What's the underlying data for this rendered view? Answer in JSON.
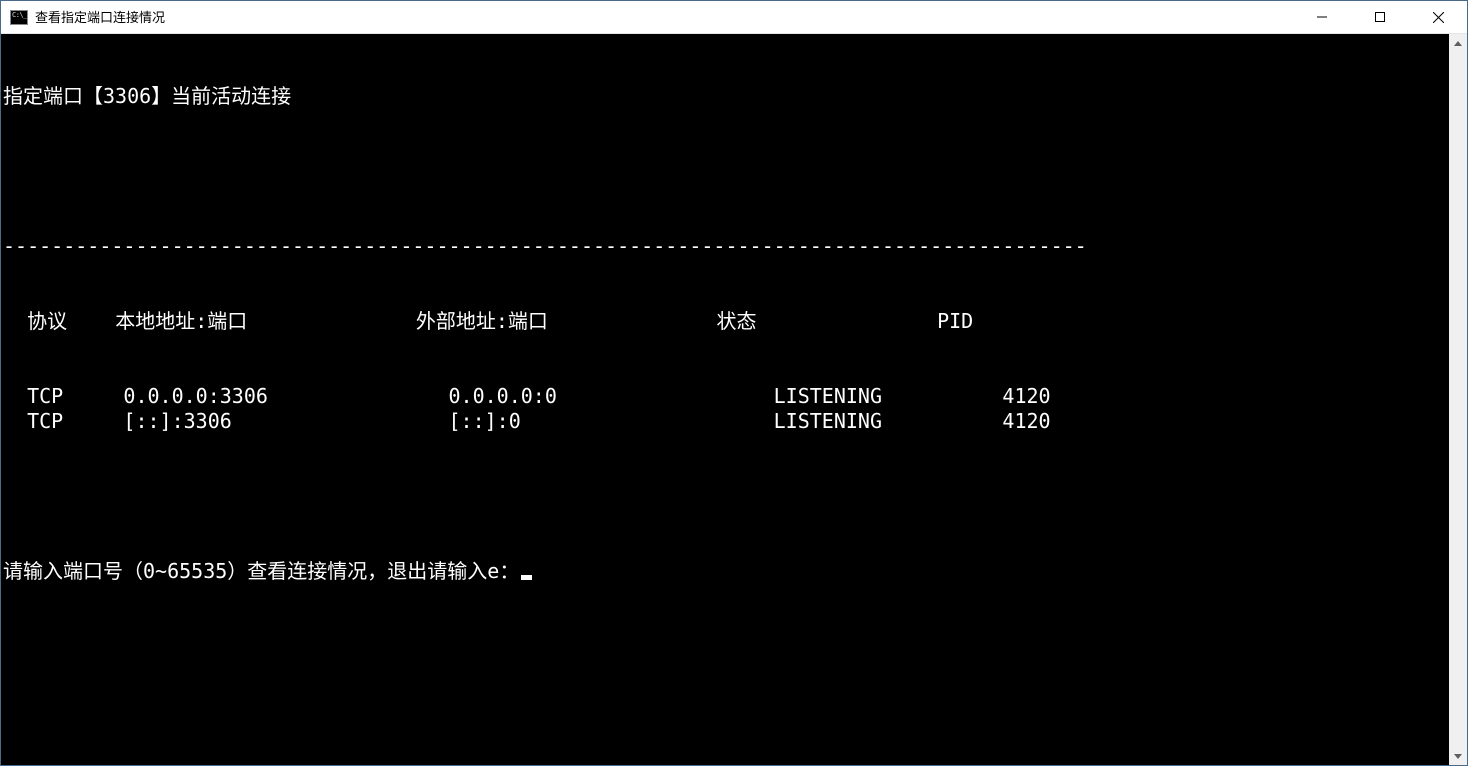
{
  "window": {
    "title": "查看指定端口连接情况"
  },
  "terminal": {
    "heading": "指定端口【3306】当前活动连接",
    "separator": "------------------------------------------------------------------------------------------",
    "columns": {
      "proto": "协议",
      "local": "本地地址:端口",
      "foreign": "外部地址:端口",
      "state": "状态",
      "pid": "PID"
    },
    "rows": [
      {
        "proto": "TCP",
        "local": "0.0.0.0:3306",
        "foreign": "0.0.0.0:0",
        "state": "LISTENING",
        "pid": "4120"
      },
      {
        "proto": "TCP",
        "local": "[::]:3306",
        "foreign": "[::]:0",
        "state": "LISTENING",
        "pid": "4120"
      }
    ],
    "prompt": "请输入端口号（0~65535）查看连接情况，退出请输入e："
  }
}
